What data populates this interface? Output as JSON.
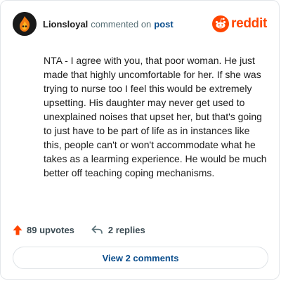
{
  "comment": {
    "username": "Lionsloyal",
    "action_text": "commented on",
    "post_link": "post",
    "brand": "reddit",
    "body": "NTA - I agree with you, that poor woman. He just made that highly uncomfortable for her. If she was trying to nurse too I feel this would be extremely upsetting. His daughter may never get used to unexplained noises that upset her, but that's going to just have to be part of life as in instances like this, people can't or won't accommodate what he takes as a learming experience. He would be much better off teaching coping mechanisms.",
    "upvotes": "89 upvotes",
    "replies": "2 replies",
    "view_comments": "View 2 comments"
  },
  "colors": {
    "brand": "#ff4500",
    "link": "#0a4d8c",
    "muted": "#576f76"
  },
  "icons": {
    "avatar": "flame-avatar",
    "brand": "reddit-snoo-icon",
    "upvote": "upvote-arrow-icon",
    "reply": "reply-arrow-icon"
  }
}
